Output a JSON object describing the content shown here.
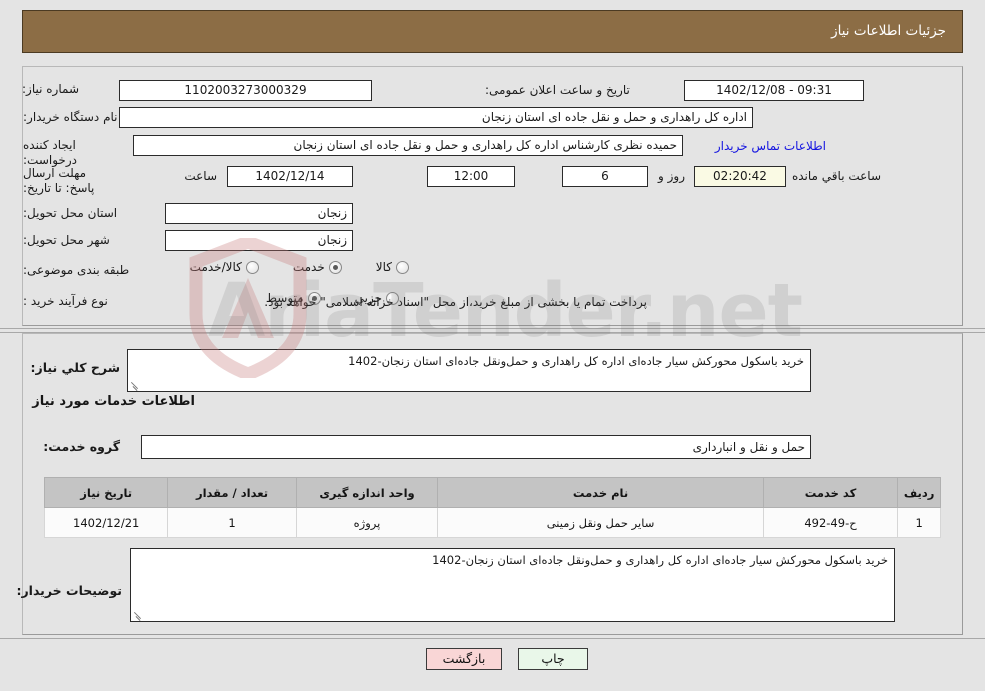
{
  "header": {
    "title": "جزئیات اطلاعات نیاز"
  },
  "summary": {
    "need_number_label": "شماره نیاز:",
    "need_number_value": "1102003273000329",
    "announce_datetime_label": "تاریخ و ساعت اعلان عمومی:",
    "announce_datetime_value": "09:31 - 1402/12/08",
    "buyer_org_label": "نام دستگاه خریدار:",
    "buyer_org_value": "اداره کل راهداری و حمل و نقل جاده ای استان زنجان",
    "creator_label": "ایجاد کننده درخواست:",
    "creator_value": "حمیده نظری کارشناس اداره کل راهداری و حمل و نقل جاده ای استان زنجان",
    "contact_link": "اطلاعات تماس خریدار",
    "deadline_label": "مهلت ارسال پاسخ: تا تاریخ:",
    "deadline_date": "1402/12/14",
    "hour_label": "ساعت",
    "deadline_time": "12:00",
    "days_remaining": "6",
    "days_separator_label": "روز و",
    "countdown": "02:20:42",
    "countdown_suffix_label": "ساعت باقي مانده",
    "delivery_province_label": "استان محل تحویل:",
    "delivery_province_value": "زنجان",
    "delivery_city_label": "شهر محل تحویل:",
    "delivery_city_value": "زنجان",
    "category_label": "طبقه بندی موضوعی:",
    "category_options": [
      {
        "label": "کالا",
        "selected": false
      },
      {
        "label": "خدمت",
        "selected": true
      },
      {
        "label": "کالا/خدمت",
        "selected": false
      }
    ],
    "process_label": "نوع فرآیند خرید :",
    "process_options": [
      {
        "label": "جزيي",
        "selected": false
      },
      {
        "label": "متوسط",
        "selected": true
      }
    ],
    "treasury_note": "پرداخت تمام یا بخشی از مبلغ خرید،از محل \"اسناد خزانه اسلامی\" خواهد بود."
  },
  "details": {
    "general_desc_label": "شرح کلي نیاز:",
    "general_desc_value": "خرید باسکول محورکش سیار جاده‌ای اداره کل راهداری و حمل‌ونقل جاده‌ای استان زنجان-1402",
    "services_section_title": "اطلاعات خدمات مورد نیاز",
    "service_group_label": "گروه خدمت:",
    "service_group_value": "حمل و نقل و انبارداری",
    "buyer_notes_label": "توضیحات خریدار:",
    "buyer_notes_value": "خرید باسکول محورکش سیار جاده‌ای اداره کل راهداری و حمل‌ونقل جاده‌ای استان زنجان-1402"
  },
  "items_table": {
    "columns": [
      "ردیف",
      "کد خدمت",
      "نام خدمت",
      "واحد اندازه گیری",
      "تعداد / مقدار",
      "تاریخ نیاز"
    ],
    "rows": [
      {
        "row_no": "1",
        "service_code": "ح-49-492",
        "service_name": "سایر حمل ونقل زمینی",
        "unit": "پروژه",
        "quantity": "1",
        "need_date": "1402/12/21"
      }
    ]
  },
  "footer": {
    "print_label": "چاپ",
    "back_label": "بازگشت"
  },
  "watermark": {
    "text": "AriaTender.net"
  },
  "colors": {
    "header_bar": "#8c6d45",
    "page_background": "#e4e4e4",
    "link": "#1414e0",
    "table_header": "#c4c4c4",
    "print_button": "#e9f7e9",
    "back_button": "#f9d6d6",
    "countdown_box": "#fafae4"
  }
}
